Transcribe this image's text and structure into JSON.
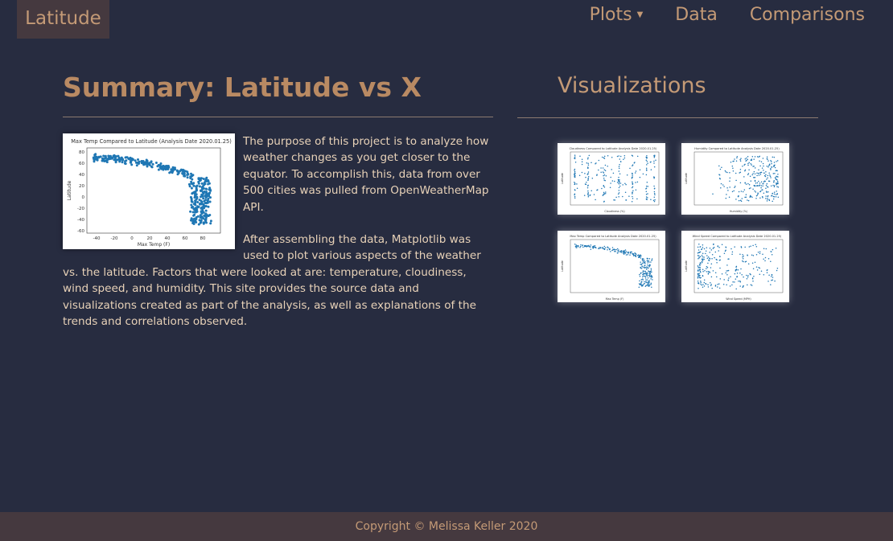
{
  "navbar": {
    "brand": "Latitude",
    "items": [
      {
        "label": "Plots",
        "has_dropdown": true
      },
      {
        "label": "Data",
        "has_dropdown": false
      },
      {
        "label": "Comparisons",
        "has_dropdown": false
      }
    ]
  },
  "summary": {
    "title": "Summary: Latitude vs X",
    "paragraphs": [
      "The purpose of this project is to analyze how weather changes as you get closer to the equator. To accomplish this, data from over 500 cities was pulled from OpenWeatherMap API.",
      "After assembling the data, Matplotlib was used to plot various aspects of the weather vs. the latitude. Factors that were looked at are: temperature, cloudiness, wind speed, and humidity. This site provides the source data and visualizations created as part of the analysis, as well as explanations of the trends and correlations observed."
    ],
    "hero_image": {
      "title": "Max Temp Compared to Latitude (Analysis Date 2020.01.25)",
      "xlabel": "Max Temp (F)",
      "ylabel": "Latitude",
      "xticks": [
        "-40",
        "-20",
        "0",
        "20",
        "40",
        "60",
        "80"
      ],
      "yticks": [
        "80",
        "60",
        "40",
        "20",
        "0",
        "-20",
        "-40",
        "-60"
      ]
    }
  },
  "visualizations": {
    "title": "Visualizations",
    "thumbnails": [
      {
        "title": "Cloudiness Compared to Latitude Analysis Date 2020.01.25)",
        "xlabel": "Cloudiness (%)",
        "ylabel": "Latitude"
      },
      {
        "title": "Humidity Compared to Latitude Analysis Date 2020.01.25)",
        "xlabel": "Humidity (%)",
        "ylabel": "Latitude"
      },
      {
        "title": "Max Temp Compared to Latitude Analysis Date 2020.01.25)",
        "xlabel": "Max Temp (F)",
        "ylabel": "Latitude"
      },
      {
        "title": "Wind Speed Compared to Latitude Analysis Date 2020.01.25)",
        "xlabel": "Wind Speed (MPH)",
        "ylabel": "Latitude"
      }
    ]
  },
  "footer": {
    "copyright": "Copyright © Melissa Keller 2020"
  },
  "colors": {
    "background": "#272c40",
    "accent": "#c49a76",
    "bar": "#45393f",
    "text": "#e8d2b8",
    "scatter_point": "#1f77b4"
  }
}
